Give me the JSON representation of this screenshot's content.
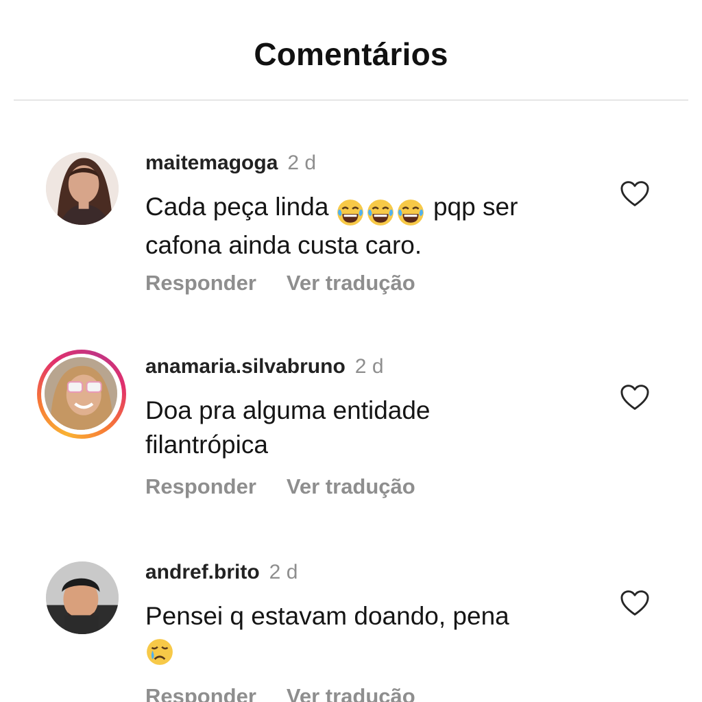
{
  "header": {
    "title": "Comentários"
  },
  "comments": [
    {
      "username": "maitemagoga",
      "time": "2 d",
      "text_before": "Cada peça linda",
      "emojis": [
        "face-with-tears-of-joy",
        "face-with-tears-of-joy",
        "face-with-tears-of-joy"
      ],
      "text_after": "pqp ser cafona ainda custa caro.",
      "reply_label": "Responder",
      "translate_label": "Ver tradução",
      "like_icon": "heart-outline-icon",
      "has_story_ring": false
    },
    {
      "username": "anamaria.silvabruno",
      "time": "2 d",
      "text": "Doa pra alguma entidade filantrópica",
      "reply_label": "Responder",
      "translate_label": "Ver tradução",
      "like_icon": "heart-outline-icon",
      "has_story_ring": true
    },
    {
      "username": "andref.brito",
      "time": "2 d",
      "text": "Pensei q estavam doando, pena",
      "emojis": [
        "crying-face"
      ],
      "reply_label": "Responder",
      "translate_label": "Ver tradução",
      "like_icon": "heart-outline-icon",
      "has_story_ring": false
    }
  ],
  "colors": {
    "muted_text": "#8e8e8e",
    "divider": "#e6e6e6",
    "story_ring_start": "#f9b233",
    "story_ring_end": "#c13584"
  }
}
